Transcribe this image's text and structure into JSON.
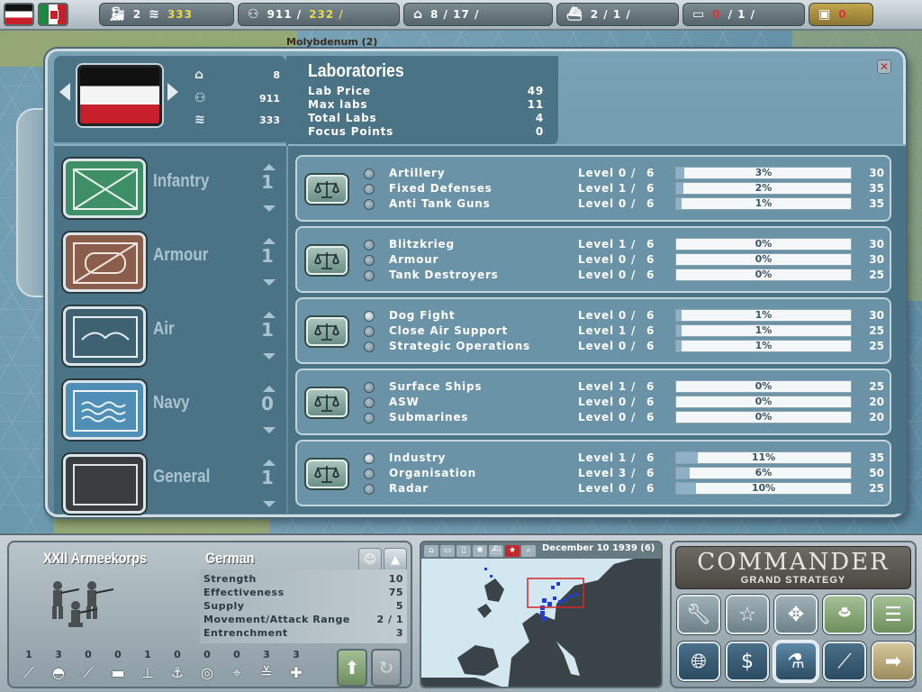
{
  "topbar": {
    "trains": "2",
    "supply": "333",
    "manpower": "911 /",
    "manpower_free": "232 /",
    "factories": "8 /  17 /",
    "ships": "2 /  1 /",
    "subs_a": "0",
    "subs_b": "/  1 /",
    "gold": "0"
  },
  "map_labels": {
    "top": "Molybdenum (2)"
  },
  "nation": {
    "factories": "8",
    "manpower": "911",
    "supply": "333"
  },
  "labs": {
    "title": "Laboratories",
    "rows": [
      {
        "label": "Lab Price",
        "value": "49"
      },
      {
        "label": "Max labs",
        "value": "11"
      },
      {
        "label": "Total Labs",
        "value": "4"
      },
      {
        "label": "Focus Points",
        "value": "0"
      }
    ]
  },
  "categories": [
    {
      "name": "Infantry",
      "count": "1",
      "icon": "infantry-symbol-icon"
    },
    {
      "name": "Armour",
      "count": "1",
      "icon": "armour-symbol-icon"
    },
    {
      "name": "Air",
      "count": "1",
      "icon": "air-symbol-icon"
    },
    {
      "name": "Navy",
      "count": "0",
      "icon": "navy-symbol-icon"
    },
    {
      "name": "General",
      "count": "1",
      "icon": "general-symbol-icon"
    }
  ],
  "groups": [
    {
      "items": [
        {
          "name": "Artillery",
          "level": "Level 0 /",
          "max": "6",
          "pct": "3%",
          "progress": 0.03,
          "cost": "30",
          "active": false
        },
        {
          "name": "Fixed Defenses",
          "level": "Level 1 /",
          "max": "6",
          "pct": "2%",
          "progress": 0.02,
          "cost": "35",
          "active": false
        },
        {
          "name": "Anti Tank Guns",
          "level": "Level 0 /",
          "max": "6",
          "pct": "1%",
          "progress": 0.01,
          "cost": "35",
          "active": false
        }
      ]
    },
    {
      "items": [
        {
          "name": "Blitzkrieg",
          "level": "Level 1 /",
          "max": "6",
          "pct": "0%",
          "progress": 0,
          "cost": "30",
          "active": false
        },
        {
          "name": "Armour",
          "level": "Level 0 /",
          "max": "6",
          "pct": "0%",
          "progress": 0,
          "cost": "30",
          "active": false
        },
        {
          "name": "Tank Destroyers",
          "level": "Level 0 /",
          "max": "6",
          "pct": "0%",
          "progress": 0,
          "cost": "25",
          "active": false
        }
      ]
    },
    {
      "items": [
        {
          "name": "Dog Fight",
          "level": "Level 0 /",
          "max": "6",
          "pct": "1%",
          "progress": 0.01,
          "cost": "30",
          "active": true
        },
        {
          "name": "Close Air Support",
          "level": "Level 1 /",
          "max": "6",
          "pct": "1%",
          "progress": 0.01,
          "cost": "25",
          "active": false
        },
        {
          "name": "Strategic Operations",
          "level": "Level 0 /",
          "max": "6",
          "pct": "1%",
          "progress": 0.01,
          "cost": "25",
          "active": false
        }
      ]
    },
    {
      "items": [
        {
          "name": "Surface Ships",
          "level": "Level 1 /",
          "max": "6",
          "pct": "0%",
          "progress": 0,
          "cost": "25",
          "active": false
        },
        {
          "name": "ASW",
          "level": "Level 0 /",
          "max": "6",
          "pct": "0%",
          "progress": 0,
          "cost": "20",
          "active": false
        },
        {
          "name": "Submarines",
          "level": "Level 0 /",
          "max": "6",
          "pct": "0%",
          "progress": 0,
          "cost": "20",
          "active": false
        }
      ]
    },
    {
      "items": [
        {
          "name": "Industry",
          "level": "Level 1 /",
          "max": "6",
          "pct": "11%",
          "progress": 0.11,
          "cost": "35",
          "active": true
        },
        {
          "name": "Organisation",
          "level": "Level 3 /",
          "max": "6",
          "pct": "6%",
          "progress": 0.06,
          "cost": "50",
          "active": false
        },
        {
          "name": "Radar",
          "level": "Level 0 /",
          "max": "6",
          "pct": "10%",
          "progress": 0.1,
          "cost": "25",
          "active": false
        }
      ]
    }
  ],
  "unit": {
    "name": "XXII Armeekorps",
    "nation": "German",
    "stats": [
      {
        "label": "Strength",
        "value": "10"
      },
      {
        "label": "Effectiveness",
        "value": "75"
      },
      {
        "label": "Supply",
        "value": "5"
      },
      {
        "label": "Movement/Attack Range",
        "value": "2 / 1"
      },
      {
        "label": "Entrenchment",
        "value": "3"
      }
    ],
    "slots": [
      {
        "count": "1",
        "icon": "rifle-icon",
        "glyph": "⟋"
      },
      {
        "count": "3",
        "icon": "helmet-icon",
        "glyph": "◓"
      },
      {
        "count": "0",
        "icon": "artillery-icon",
        "glyph": "⟋"
      },
      {
        "count": "0",
        "icon": "tank-icon",
        "glyph": "▬"
      },
      {
        "count": "1",
        "icon": "anti-tank-icon",
        "glyph": "⊥"
      },
      {
        "count": "0",
        "icon": "anchor-icon",
        "glyph": "⚓"
      },
      {
        "count": "0",
        "icon": "radar-icon",
        "glyph": "◎"
      },
      {
        "count": "0",
        "icon": "crosshair-icon",
        "glyph": "⌖"
      },
      {
        "count": "3",
        "icon": "chevrons-icon",
        "glyph": "≚"
      },
      {
        "count": "3",
        "icon": "medic-cross-icon",
        "glyph": "✚"
      }
    ]
  },
  "minimap": {
    "date": "December 10 1939 (6)"
  },
  "commander": {
    "title": "Commander",
    "subtitle": "Grand Strategy"
  }
}
